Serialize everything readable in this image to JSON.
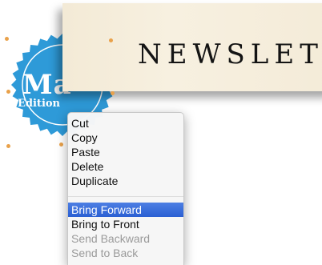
{
  "banner": {
    "title": "NEWSLET"
  },
  "badge": {
    "big_text": "Ma",
    "small_text": "Edition",
    "color": "#2e9ad8"
  },
  "context_menu": {
    "items": [
      {
        "label": "Cut",
        "state": "enabled"
      },
      {
        "label": "Copy",
        "state": "enabled"
      },
      {
        "label": "Paste",
        "state": "enabled"
      },
      {
        "label": "Delete",
        "state": "enabled"
      },
      {
        "label": "Duplicate",
        "state": "enabled"
      },
      {
        "label": "Bring Forward",
        "state": "highlighted"
      },
      {
        "label": "Bring to Front",
        "state": "enabled"
      },
      {
        "label": "Send Backward",
        "state": "disabled"
      },
      {
        "label": "Send to Back",
        "state": "disabled"
      }
    ],
    "highlight_color": "#2f63d6"
  },
  "handle_color": "#e9a14a"
}
